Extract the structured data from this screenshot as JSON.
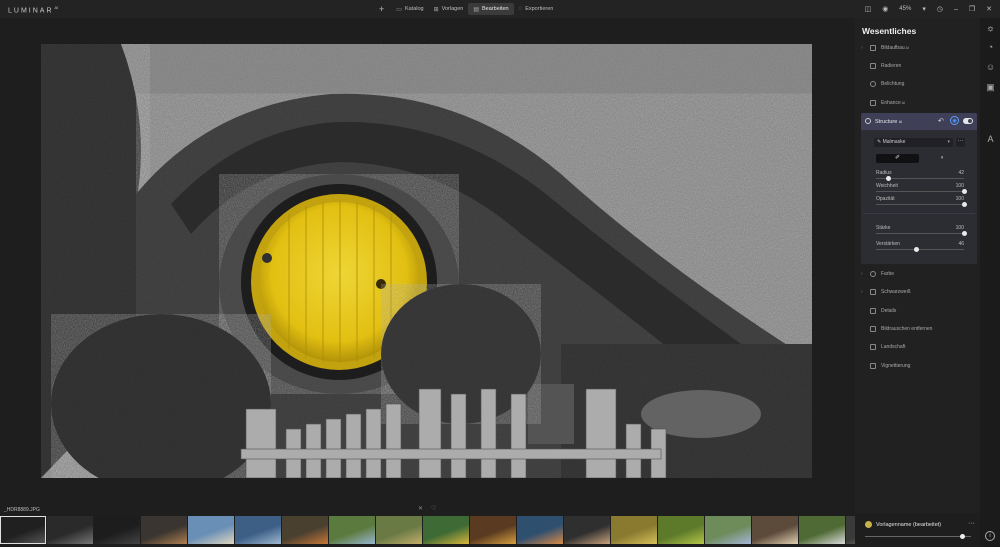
{
  "app": {
    "logo": "LUMINAR",
    "version": "AI"
  },
  "topbar": {
    "nav": [
      {
        "label": "Katalog",
        "icon": "catalog-icon",
        "active": false
      },
      {
        "label": "Vorlagen",
        "icon": "presets-icon",
        "active": false
      },
      {
        "label": "Bearbeiten",
        "icon": "edit-icon",
        "active": true
      },
      {
        "label": "Exportieren",
        "icon": "export-icon",
        "active": false
      }
    ],
    "zoom": "45%"
  },
  "panel": {
    "title": "Wesentliches",
    "tools_above": [
      {
        "label": "Bildaufbau",
        "badge": "AI",
        "chevron": true
      },
      {
        "label": "Radieren",
        "badge": "",
        "chevron": false
      },
      {
        "label": "Belichtung",
        "badge": "",
        "chevron": false
      },
      {
        "label": "Enhance",
        "badge": "AI",
        "chevron": false
      }
    ],
    "structure": {
      "label": "Structure",
      "badge": "AI",
      "mask_type": "Malmaske",
      "sliders_top": [
        {
          "label": "Radius",
          "value": 42,
          "fraction": 0.14
        },
        {
          "label": "Weichheit",
          "value": 100,
          "fraction": 1.0
        },
        {
          "label": "Opazität",
          "value": 100,
          "fraction": 1.0
        }
      ],
      "sliders_bottom": [
        {
          "label": "Stärke",
          "value": 100,
          "fraction": 1.0
        },
        {
          "label": "Verstärken",
          "value": 46,
          "fraction": 0.46
        }
      ]
    },
    "tools_below": [
      {
        "label": "Farbe",
        "chevron": true
      },
      {
        "label": "Schwarzweiß",
        "chevron": true
      },
      {
        "label": "Details",
        "chevron": false
      },
      {
        "label": "Bildrauschen entfernen",
        "chevron": false
      },
      {
        "label": "Landschaft",
        "chevron": false
      },
      {
        "label": "Vignettierung",
        "chevron": false
      }
    ]
  },
  "filmstrip": {
    "filename": "_HDR8889.JPG",
    "thumbs": [
      {
        "color": "#202020",
        "accent": "#5a5a5a"
      },
      {
        "color": "#2a2a2a",
        "accent": "#777777"
      },
      {
        "color": "#1d1d1d",
        "accent": "#444444"
      },
      {
        "color": "#3a3530",
        "accent": "#b08050"
      },
      {
        "color": "#6a8fb6",
        "accent": "#e0d8c0"
      },
      {
        "color": "#3d5f86",
        "accent": "#9fb8d0"
      },
      {
        "color": "#4a4030",
        "accent": "#c87838"
      },
      {
        "color": "#5b7a3d",
        "accent": "#9ab7d1"
      },
      {
        "color": "#6a7a45",
        "accent": "#c4b06a"
      },
      {
        "color": "#3e6a35",
        "accent": "#d9b83a"
      },
      {
        "color": "#5a3a20",
        "accent": "#d8a040"
      },
      {
        "color": "#2f4f6f",
        "accent": "#d98b48"
      },
      {
        "color": "#2f2f2f",
        "accent": "#c9a27c"
      },
      {
        "color": "#8a7a30",
        "accent": "#d7c25a"
      },
      {
        "color": "#5d7a2a",
        "accent": "#b6c648"
      },
      {
        "color": "#6e8b5a",
        "accent": "#a4b6d8"
      },
      {
        "color": "#5c4a3a",
        "accent": "#e0d0b0"
      },
      {
        "color": "#4f6a35",
        "accent": "#dcdcdc"
      },
      {
        "color": "#3a3a3a",
        "accent": "#9a8a7a"
      }
    ]
  },
  "preset": {
    "name": "Vorlagenname (bearbeitet)",
    "fraction": 0.92
  }
}
